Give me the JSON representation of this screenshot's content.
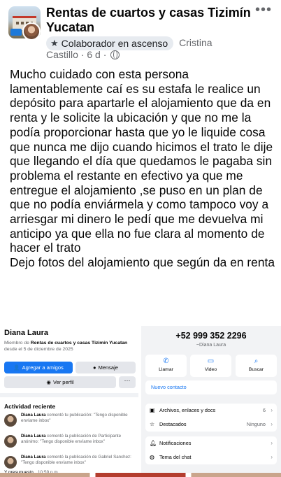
{
  "post": {
    "group_name": "Rentas de cuartos y casas Tizimín Yucatan",
    "badge_label": "Colaborador en ascenso",
    "author_first": "Cristina",
    "author_last": "Castillo",
    "time": "6 d",
    "body": "Mucho cuidado con esta persona lamentablemente caí es su estafa le realice un depósito para apartarle el alojamiento que da en renta y le solicite la ubicación y que no me la podía proporcionar hasta que yo le liquide cosa que nunca me dijo cuando hicimos el trato le dije que llegando el día que quedamos le pagaba sin problema el restante en efectivo ya que me entregue el alojamiento ,se puso en un plan de que no podía enviármela y como tampoco voy a arriesgar mi dinero le pedí que me devuelva mi anticipo ya que ella no fue clara al momento de hacer el trato\nDejo fotos del alojamiento que según da en renta",
    "icons": {
      "more": "more-dots-icon",
      "badge": "star-icon",
      "privacy": "globe-icon"
    }
  },
  "profile_panel": {
    "name": "Diana Laura",
    "member_prefix": "Miembro de ",
    "member_group": "Rentas de cuartos y casas Tizimín Yucatan",
    "member_since": "desde el 5 de diciembre de 2025",
    "add_friend": "Agregar a amigos",
    "message": "Mensaje",
    "view_profile": "Ver perfil",
    "more": "···",
    "activity_title": "Actividad reciente",
    "activities": [
      {
        "actor": "Diana Laura",
        "text": " comentó tu publicación: \"Tengo disponible envíame inbox\""
      },
      {
        "actor": "Diana Laura",
        "text": " comentó la publicación de Participante anónimo: \"Tengo disponible envíame inbox\""
      },
      {
        "actor": "Diana Laura",
        "text": " comentó la publicación de Gabriel Sanchez: \"Tengo disponible envíame inbox\""
      }
    ],
    "footer_text": "Y presupuesto",
    "footer_time": "10:59 p.m."
  },
  "contact_panel": {
    "phone": "+52 999 352 2296",
    "contact_name": "~Diana Laura",
    "actions": [
      {
        "label": "Llamar",
        "icon": "phone-icon"
      },
      {
        "label": "Video",
        "icon": "video-icon"
      },
      {
        "label": "Buscar",
        "icon": "search-icon"
      }
    ],
    "new_contact": "Nuevo contacto",
    "rows1": [
      {
        "label": "Archivos, enlaces y docs",
        "value": "6",
        "icon": "photo-icon"
      },
      {
        "label": "Destacados",
        "value": "Ninguno",
        "icon": "star-icon"
      }
    ],
    "rows2": [
      {
        "label": "Notificaciones",
        "value": "",
        "icon": "bell-icon"
      },
      {
        "label": "Tema del chat",
        "value": "",
        "icon": "palette-icon"
      }
    ]
  }
}
